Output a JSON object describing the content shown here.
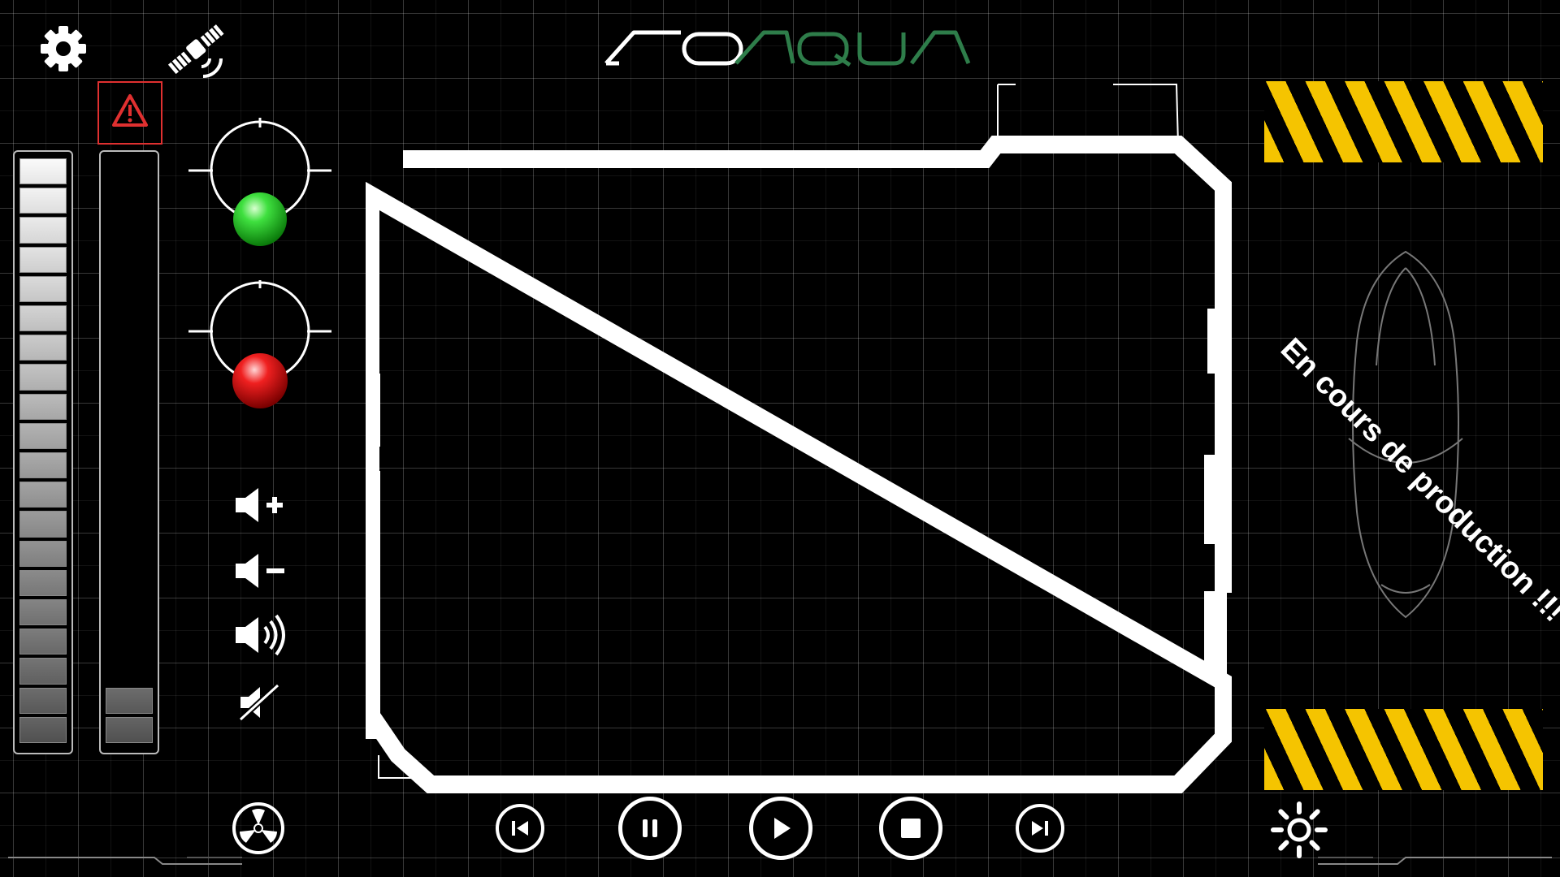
{
  "app": {
    "logo_left": "AO",
    "logo_right": "AQUA",
    "logo_color_left": "#ffffff",
    "logo_color_right": "#2e7d4a"
  },
  "status_panel": {
    "production_notice": "En cours de production !!!",
    "hazard_color": "#f5c400"
  },
  "indicators": {
    "light_1": {
      "color": "#22c422",
      "icon": "green-light-icon"
    },
    "light_2": {
      "color": "#d41111",
      "icon": "red-light-icon"
    }
  },
  "meters": {
    "level_left": {
      "segments": 20,
      "filled": 20
    },
    "level_right": {
      "segments": 20,
      "filled": 2
    },
    "alert_icon": "warning-icon",
    "alert_color": "#e03030"
  },
  "volume_controls": [
    "volume-up-icon",
    "volume-down-icon",
    "volume-icon",
    "mute-icon"
  ],
  "top_icons": [
    "gear-icon",
    "satellite-icon"
  ],
  "bottom_icons": [
    "fan-icon",
    "brightness-icon"
  ],
  "media_controls": [
    "previous-icon",
    "pause-icon",
    "play-icon",
    "stop-icon",
    "next-icon"
  ]
}
